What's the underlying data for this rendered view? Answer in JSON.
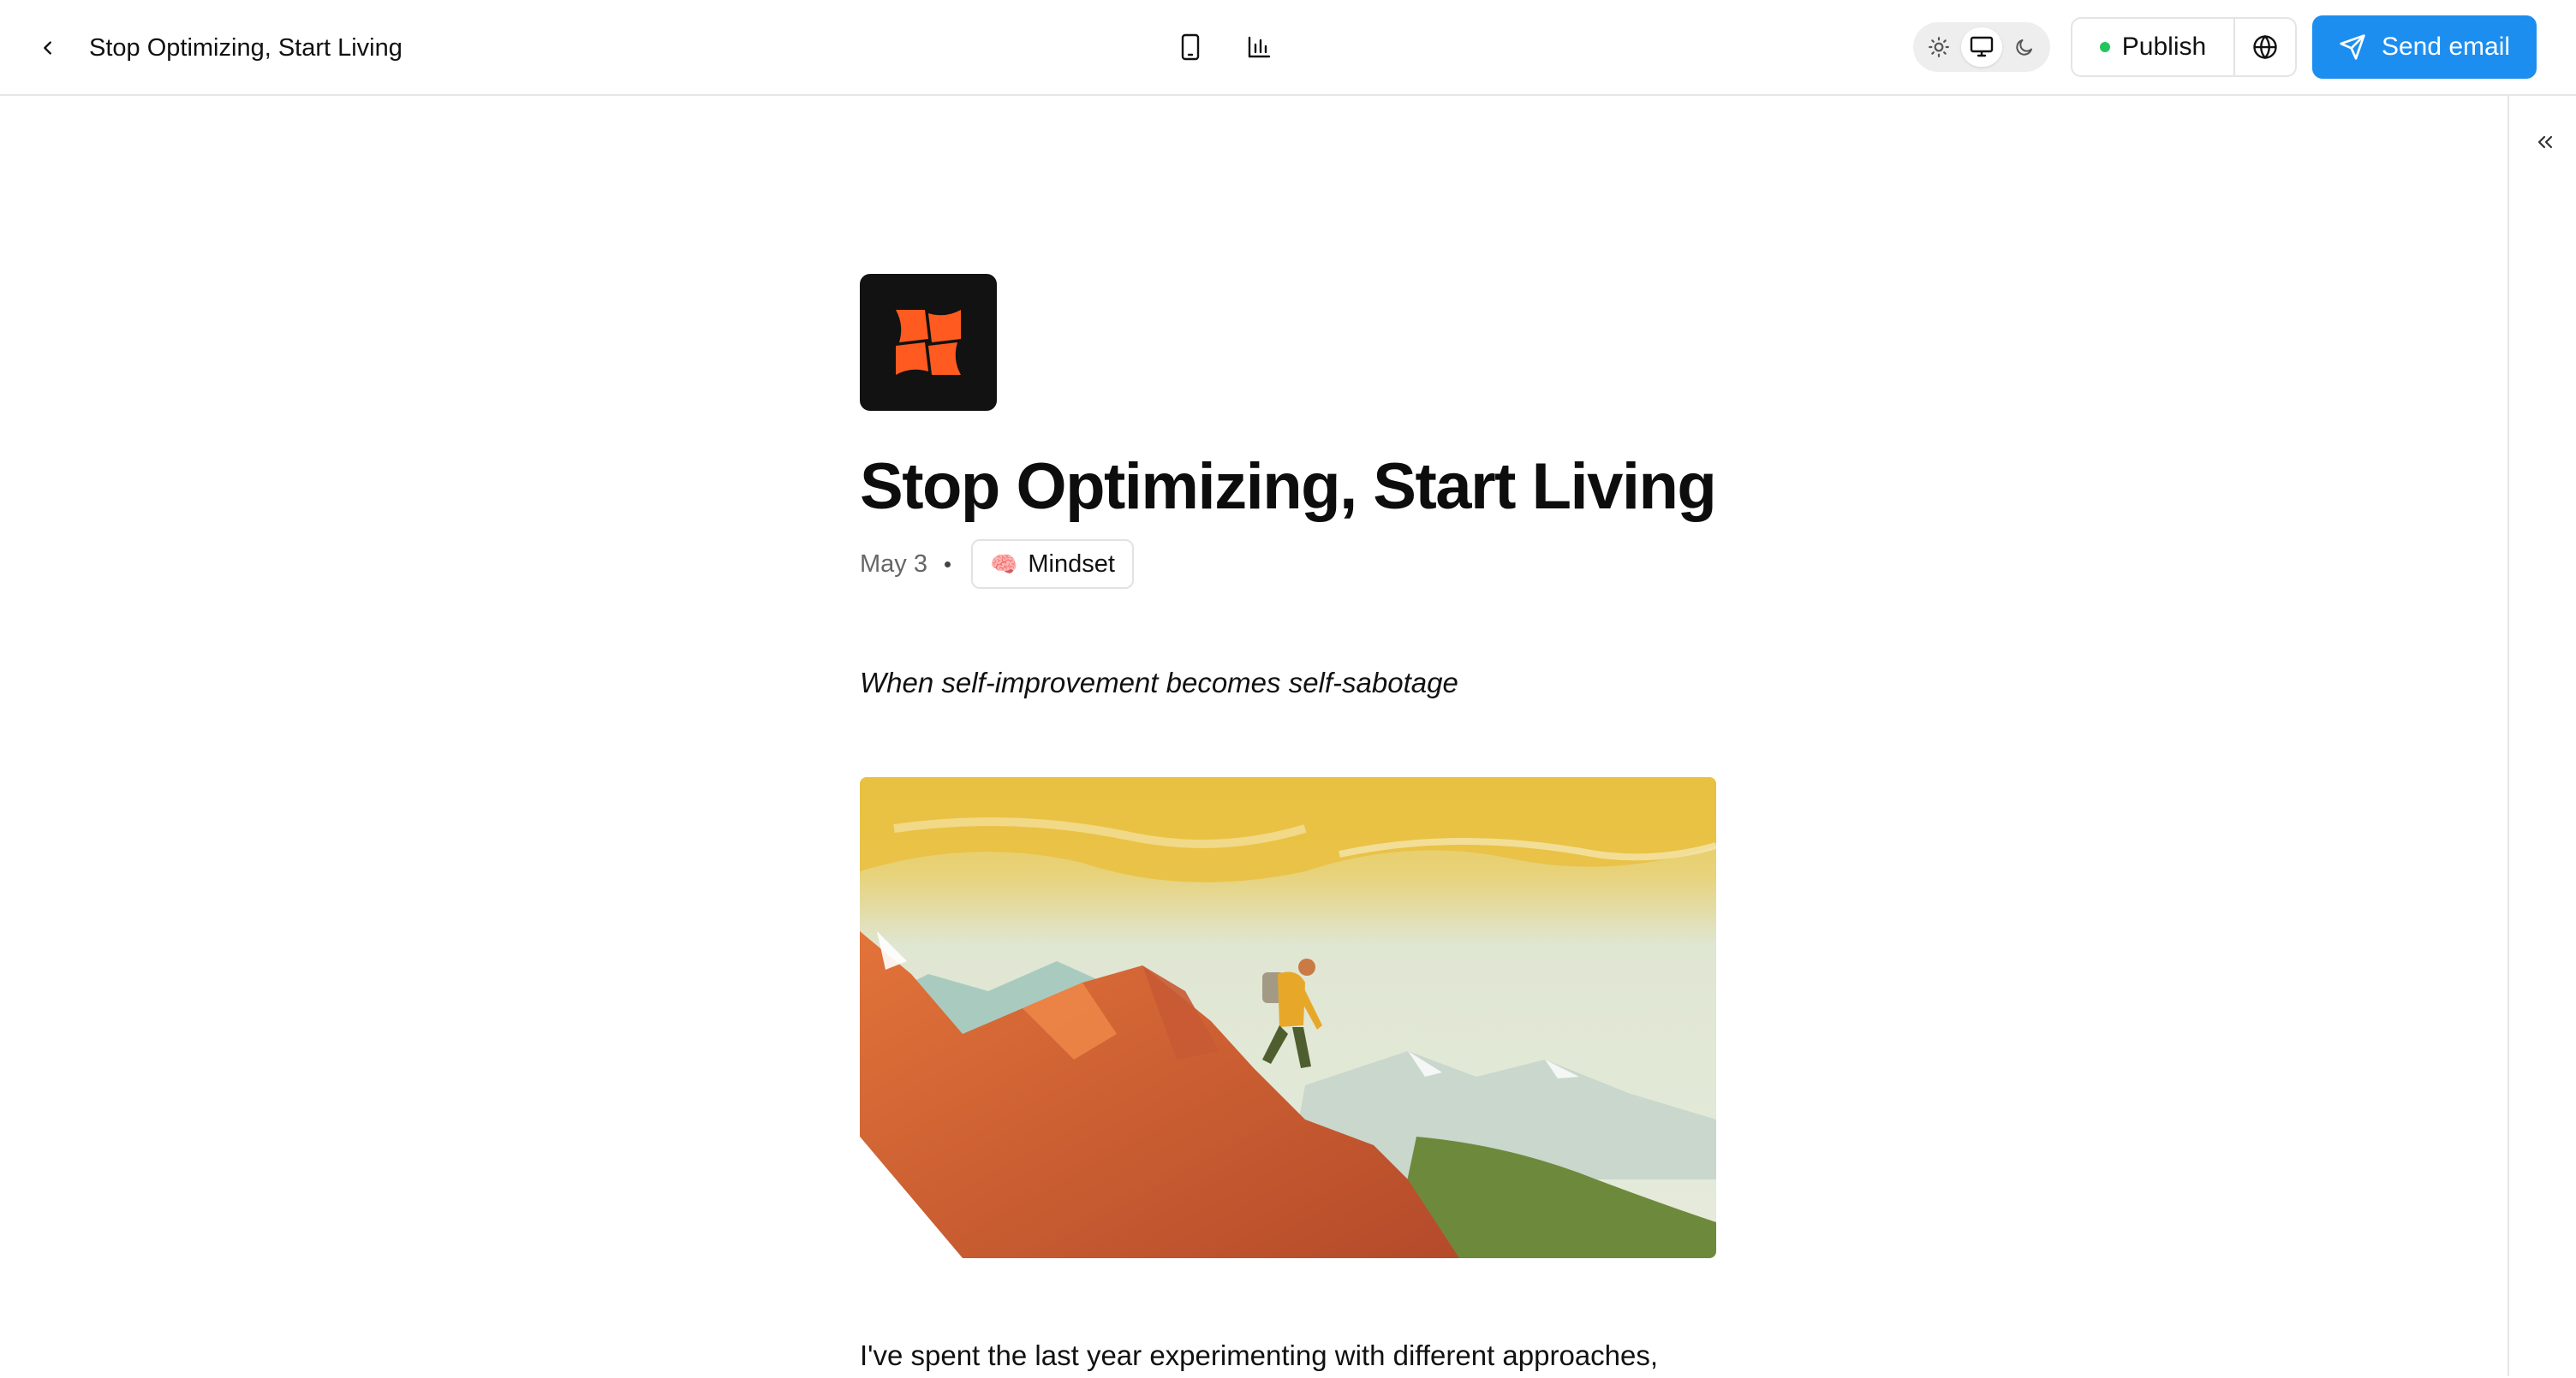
{
  "topbar": {
    "title": "Stop Optimizing, Start Living",
    "publish_label": "Publish",
    "send_label": "Send email",
    "publish_status_color": "#22c55e",
    "send_color": "#1c8ef0",
    "theme_options": [
      "sun-icon",
      "desktop-icon",
      "moon-icon"
    ],
    "theme_selected": "desktop-icon"
  },
  "article": {
    "title": "Stop Optimizing, Start Living",
    "date": "May 3",
    "tag": {
      "emoji": "🧠",
      "label": "Mindset"
    },
    "subtitle": "When self-improvement becomes self-sabotage",
    "body_first_line": "I've spent the last year experimenting with different approaches,",
    "logo_color": "#ff5a1f"
  }
}
